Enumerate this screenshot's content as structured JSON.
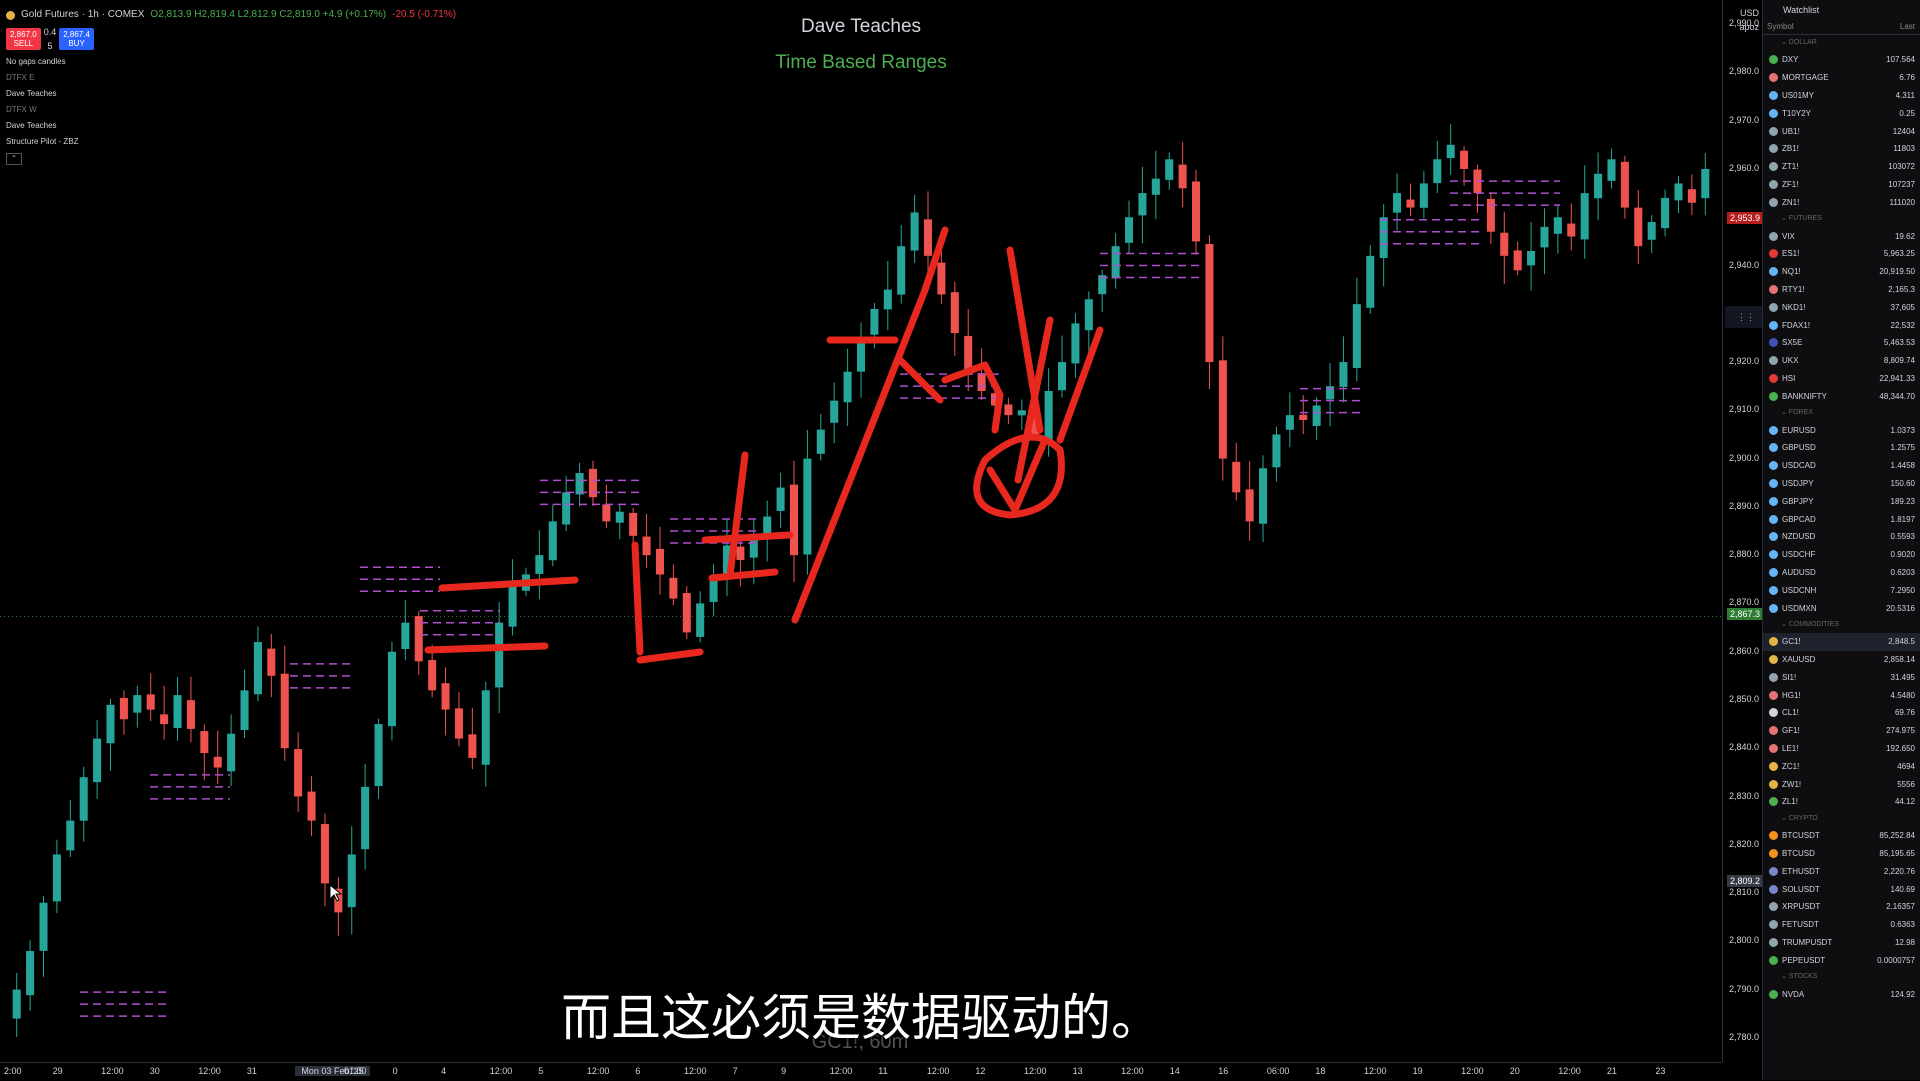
{
  "header": {
    "symbol": "Gold Futures · 1h · COMEX",
    "ohlc": "O2,813.9 H2,819.4 L2,812.9 C2,819.0 +4.9 (+0.17%)",
    "change": "-20.5 (-0.71%)",
    "sell_price": "2,867.0",
    "sell_label": "SELL",
    "spread": "0.4",
    "qty": "5",
    "buy_price": "2,867.4",
    "buy_label": "BUY"
  },
  "indicators": [
    "No gaps candles",
    "DTFX E",
    "Dave Teaches",
    "DTFX W",
    "Dave Teaches",
    "Structure Pilot - ZBZ"
  ],
  "titles": {
    "main": "Dave Teaches",
    "sub": "Time Based Ranges"
  },
  "subtitle": "而且这必须是数据驱动的。",
  "watermark": "GC1!, 60m",
  "y_axis": {
    "currency": "USD",
    "mode": "apoz",
    "ticks": [
      "2,990.0",
      "2,980.0",
      "2,970.0",
      "2,960.0",
      "2,950.0",
      "2,940.0",
      "2,930.0",
      "2,920.0",
      "2,910.0",
      "2,900.0",
      "2,890.0",
      "2,880.0",
      "2,870.0",
      "2,860.0",
      "2,850.0",
      "2,840.0",
      "2,830.0",
      "2,820.0",
      "2,810.0",
      "2,800.0",
      "2,790.0",
      "2,780.0"
    ],
    "badge_red": "2,953.9",
    "badge_green": "2,867.3",
    "badge_cursor": "2,809.2"
  },
  "x_axis": {
    "ticks": [
      "2:00",
      "29",
      "12:00",
      "30",
      "12:00",
      "31",
      "Mon 03 Feb '25",
      "01:00",
      "0",
      "4",
      "12:00",
      "5",
      "12:00",
      "6",
      "12:00",
      "7",
      "9",
      "12:00",
      "11",
      "12:00",
      "12",
      "12:00",
      "13",
      "12:00",
      "14",
      "16",
      "06:00",
      "18",
      "12:00",
      "19",
      "12:00",
      "20",
      "12:00",
      "21",
      "23"
    ],
    "cursor_label": "Mon 03 Feb '25  01:00"
  },
  "toolbar": {
    "size": "20px"
  },
  "watchlist": {
    "title": "Watchlist",
    "col_symbol": "Symbol",
    "col_last": "Last",
    "sections": [
      {
        "name": "DOLLAR",
        "items": [
          {
            "sym": "DXY",
            "last": "107.564",
            "color": "#4caf50"
          },
          {
            "sym": "MORTGAGE",
            "last": "6.76",
            "color": "#e57373"
          },
          {
            "sym": "US01MY",
            "last": "4.311",
            "color": "#64b5f6"
          },
          {
            "sym": "T10Y2Y",
            "last": "0.25",
            "color": "#64b5f6"
          },
          {
            "sym": "UB1!",
            "last": "12404",
            "color": "#90a4ae"
          },
          {
            "sym": "ZB1!",
            "last": "11803",
            "color": "#90a4ae"
          },
          {
            "sym": "ZT1!",
            "last": "103072",
            "color": "#90a4ae"
          },
          {
            "sym": "ZF1!",
            "last": "107237",
            "color": "#90a4ae"
          },
          {
            "sym": "ZN1!",
            "last": "111020",
            "color": "#90a4ae"
          }
        ]
      },
      {
        "name": "FUTURES",
        "items": [
          {
            "sym": "VIX",
            "last": "19.62",
            "color": "#90a4ae"
          },
          {
            "sym": "ES1!",
            "last": "5,963.25",
            "color": "#e53935"
          },
          {
            "sym": "NQ1!",
            "last": "20,919.50",
            "color": "#64b5f6"
          },
          {
            "sym": "RTY1!",
            "last": "2,165.3",
            "color": "#e57373"
          },
          {
            "sym": "NKD1!",
            "last": "37,605",
            "color": "#90a4ae"
          },
          {
            "sym": "FDAX1!",
            "last": "22,532",
            "color": "#64b5f6"
          },
          {
            "sym": "SX5E",
            "last": "5,463.53",
            "color": "#3f51b5"
          },
          {
            "sym": "UKX",
            "last": "8,809.74",
            "color": "#90a4ae"
          },
          {
            "sym": "HSI",
            "last": "22,941.33",
            "color": "#e53935"
          },
          {
            "sym": "BANKNIFTY",
            "last": "48,344.70",
            "color": "#4caf50"
          }
        ]
      },
      {
        "name": "FOREX",
        "items": [
          {
            "sym": "EURUSD",
            "last": "1.0373",
            "color": "#64b5f6"
          },
          {
            "sym": "GBPUSD",
            "last": "1.2575",
            "color": "#64b5f6"
          },
          {
            "sym": "USDCAD",
            "last": "1.4458",
            "color": "#64b5f6"
          },
          {
            "sym": "USDJPY",
            "last": "150.60",
            "color": "#64b5f6"
          },
          {
            "sym": "GBPJPY",
            "last": "189.23",
            "color": "#64b5f6"
          },
          {
            "sym": "GBPCAD",
            "last": "1.8197",
            "color": "#64b5f6"
          },
          {
            "sym": "NZDUSD",
            "last": "0.5593",
            "color": "#64b5f6"
          },
          {
            "sym": "USDCHF",
            "last": "0.9020",
            "color": "#64b5f6"
          },
          {
            "sym": "AUDUSD",
            "last": "0.6203",
            "color": "#64b5f6"
          },
          {
            "sym": "USDCNH",
            "last": "7.2950",
            "color": "#64b5f6"
          },
          {
            "sym": "USDMXN",
            "last": "20.5316",
            "color": "#64b5f6"
          }
        ]
      },
      {
        "name": "COMMODITIES",
        "items": [
          {
            "sym": "GC1!",
            "last": "2,848.5",
            "color": "#e5b447",
            "selected": true
          },
          {
            "sym": "XAUUSD",
            "last": "2,858.14",
            "color": "#e5b447"
          },
          {
            "sym": "SI1!",
            "last": "31.495",
            "color": "#90a4ae"
          },
          {
            "sym": "HG1!",
            "last": "4.5480",
            "color": "#e57373"
          },
          {
            "sym": "CL1!",
            "last": "69.76",
            "color": "#d1d4dc"
          },
          {
            "sym": "GF1!",
            "last": "274.975",
            "color": "#e57373"
          },
          {
            "sym": "LE1!",
            "last": "192.650",
            "color": "#e57373"
          },
          {
            "sym": "ZC1!",
            "last": "4694",
            "color": "#e5b447"
          },
          {
            "sym": "ZW1!",
            "last": "5556",
            "color": "#e5b447"
          },
          {
            "sym": "ZL1!",
            "last": "44.12",
            "color": "#4caf50"
          }
        ]
      },
      {
        "name": "CRYPTO",
        "items": [
          {
            "sym": "BTCUSDT",
            "last": "85,252.84",
            "color": "#f7931a"
          },
          {
            "sym": "BTCUSD",
            "last": "85,195.65",
            "color": "#f7931a"
          },
          {
            "sym": "ETHUSDT",
            "last": "2,220.76",
            "color": "#7986cb"
          },
          {
            "sym": "SOLUSDT",
            "last": "140.69",
            "color": "#7986cb"
          },
          {
            "sym": "XRPUSDT",
            "last": "2.16357",
            "color": "#90a4ae"
          },
          {
            "sym": "FETUSDT",
            "last": "0.6363",
            "color": "#90a4ae"
          },
          {
            "sym": "TRUMPUSDT",
            "last": "12.98",
            "color": "#90a4ae"
          },
          {
            "sym": "PEPEUSDT",
            "last": "0.0000757",
            "color": "#4caf50"
          }
        ]
      },
      {
        "name": "STOCKS",
        "items": [
          {
            "sym": "NVDA",
            "last": "124.92",
            "color": "#4caf50"
          }
        ]
      }
    ]
  },
  "chart_data": {
    "type": "candlestick",
    "ylim": [
      2775,
      2995
    ],
    "closes": [
      2790,
      2798,
      2808,
      2818,
      2825,
      2834,
      2842,
      2849,
      2846,
      2851,
      2848,
      2845,
      2851,
      2844,
      2839,
      2836,
      2843,
      2852,
      2862,
      2855,
      2840,
      2830,
      2825,
      2812,
      2806,
      2818,
      2832,
      2845,
      2860,
      2866,
      2858,
      2852,
      2848,
      2842,
      2838,
      2852,
      2866,
      2874,
      2876,
      2880,
      2887,
      2893,
      2897,
      2892,
      2887,
      2889,
      2884,
      2880,
      2876,
      2871,
      2864,
      2870,
      2875,
      2882,
      2879,
      2884,
      2888,
      2894,
      2880,
      2900,
      2906,
      2912,
      2918,
      2925,
      2931,
      2935,
      2944,
      2951,
      2942,
      2934,
      2926,
      2918,
      2914,
      2911,
      2909,
      2910,
      2905,
      2914,
      2920,
      2928,
      2933,
      2938,
      2944,
      2950,
      2955,
      2958,
      2962,
      2956,
      2945,
      2920,
      2900,
      2893,
      2887,
      2898,
      2905,
      2909,
      2908,
      2911,
      2915,
      2920,
      2932,
      2942,
      2950,
      2955,
      2952,
      2957,
      2962,
      2965,
      2960,
      2955,
      2947,
      2942,
      2939,
      2943,
      2948,
      2950,
      2946,
      2955,
      2959,
      2962,
      2952,
      2944,
      2949,
      2954,
      2957,
      2953,
      2960
    ]
  },
  "colors": {
    "up": "#26a69a",
    "down": "#ef5350",
    "range": "#b04fd0",
    "ink": "#e8281e",
    "accent": "#4caf50"
  }
}
